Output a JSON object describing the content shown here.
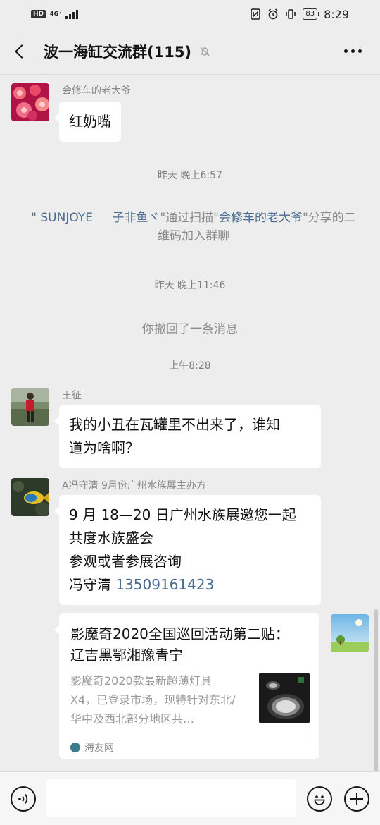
{
  "status_bar": {
    "hd": "HD",
    "network": "4G⁺",
    "network_sub": "4G",
    "battery": "83",
    "time": "8:29"
  },
  "header": {
    "title": "波一海缸交流群(115)",
    "icons": [
      "back-icon",
      "mute-icon",
      "more-icon"
    ]
  },
  "messages": [
    {
      "sender": "会修车的老大爷",
      "text": "红奶嘴",
      "avatar": "jellyfish-avatar"
    },
    {
      "time": "昨天 晚上6:57"
    },
    {
      "system": {
        "name_part1": "\" SUNJOYE",
        "name_part2": "子非鱼ヾ",
        "text_a": "\"通过扫描\"",
        "inviter": "会修车的老大爷",
        "text_b": "\"分享的二维码加入群聊"
      }
    },
    {
      "time": "昨天 晚上11:46"
    },
    {
      "recall": "你撤回了一条消息"
    },
    {
      "time": "上午8:28"
    },
    {
      "sender": "王征",
      "text_line1": "我的小丑在瓦罐里不出来了，谁知",
      "text_line2": "道为啥啊？"
    },
    {
      "sender": "A冯守清 9月份广州水族展主办方",
      "line1": "9 月 18—20 日广州水族展邀您一起",
      "line2": "共度水族盛会",
      "line3": "参观或者参展咨询",
      "line4_name": "冯守清 ",
      "line4_phone": "13509161423"
    },
    {
      "link_card": {
        "title": "影魔奇2020全国巡回活动第二贴： 辽吉黑鄂湘豫青宁",
        "description": "影魔奇2020款最新超薄灯具X4，已登录市场，现特针对东北/华中及西北部分地区共…",
        "source": "海友网"
      }
    }
  ],
  "input_bar": {
    "placeholder": "",
    "icons": [
      "voice-icon",
      "emoji-icon",
      "plus-icon"
    ]
  },
  "colors": {
    "background": "#ededed",
    "link": "#4a6b8f",
    "bubble": "#ffffff"
  }
}
